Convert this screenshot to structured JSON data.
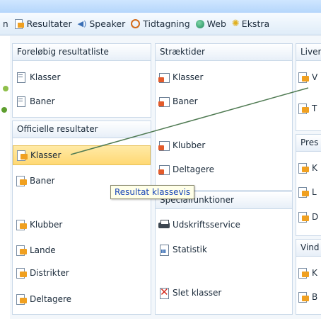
{
  "menubar": {
    "edge_letter": "n",
    "items": [
      {
        "label": "Resultater",
        "icon": "result-icon"
      },
      {
        "label": "Speaker",
        "icon": "speaker-icon"
      },
      {
        "label": "Tidtagning",
        "icon": "stopwatch-icon"
      },
      {
        "label": "Web",
        "icon": "globe-icon"
      },
      {
        "label": "Ekstra",
        "icon": "star-icon"
      }
    ]
  },
  "col1": {
    "section1": {
      "title": "Foreløbig resultatliste",
      "items": [
        "Klasser",
        "Baner"
      ]
    },
    "section2": {
      "title": "Officielle resultater",
      "items": [
        "Klasser",
        "Baner",
        "Klubber",
        "Lande",
        "Distrikter",
        "Deltagere"
      ]
    }
  },
  "col2": {
    "section1": {
      "title": "Stræktider",
      "items": [
        "Klasser",
        "Baner",
        "Klubber",
        "Deltagere"
      ]
    },
    "section2": {
      "title": "Specialfunktioner",
      "items": [
        "Udskriftsservice",
        "Statistik",
        "Slet klasser"
      ]
    }
  },
  "col3": {
    "section1": {
      "title": "Liver",
      "items": [
        "V",
        "T"
      ]
    },
    "section2": {
      "title": "Pres",
      "items": [
        "K",
        "L",
        "D"
      ]
    },
    "section3": {
      "title": "Vind",
      "items": [
        "K",
        "B"
      ]
    }
  },
  "tooltip": "Resultat klassevis",
  "colors": {
    "highlight": "#ffd873",
    "tooltip_text": "#1846b8",
    "pointer_line": "#4f7a52"
  }
}
